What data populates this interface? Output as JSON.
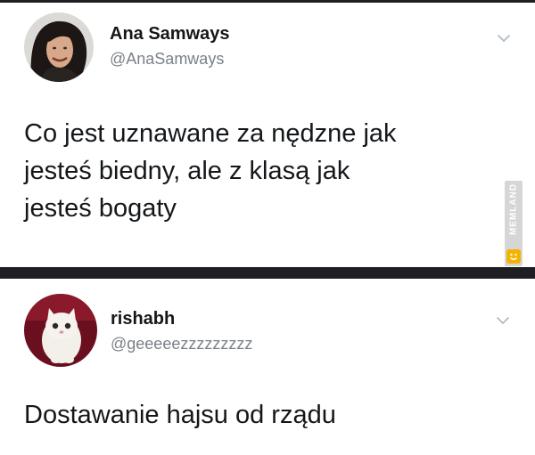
{
  "tweets": [
    {
      "name": "Ana Samways",
      "handle": "@AnaSamways",
      "text_lines": [
        "Co jest uznawane za nędzne jak",
        "jesteś biedny, ale z klasą jak",
        "jesteś bogaty"
      ],
      "avatar_icon": "profile-photo-woman",
      "menu_icon": "chevron-down-icon"
    },
    {
      "name": "rishabh",
      "handle": "@geeeeezzzzzzzzz",
      "text_lines": [
        "Dostawanie hajsu od rządu"
      ],
      "avatar_icon": "profile-photo-kitten",
      "menu_icon": "chevron-down-icon"
    }
  ],
  "watermark": {
    "text": "MEMLAND",
    "icon": "smiley-icon"
  },
  "colors": {
    "text": "#14171a",
    "handle": "#7b8188",
    "divider": "#1f1f23",
    "chevron": "#aab8c2"
  }
}
